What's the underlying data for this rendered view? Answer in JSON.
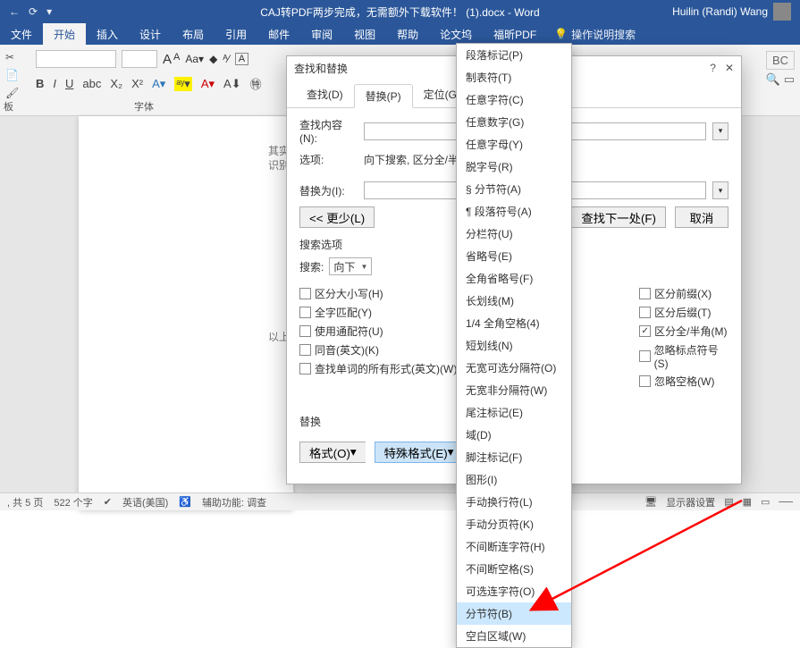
{
  "app": {
    "title": "CAJ转PDF两步完成，无需额外下载软件！ (1).docx - Word",
    "user": "Huilin (Randi) Wang"
  },
  "qat": [
    "←",
    "⟳",
    "▾"
  ],
  "ribbon_tabs": [
    {
      "label": "文件"
    },
    {
      "label": "开始",
      "active": true
    },
    {
      "label": "插入"
    },
    {
      "label": "设计"
    },
    {
      "label": "布局"
    },
    {
      "label": "引用"
    },
    {
      "label": "邮件"
    },
    {
      "label": "审阅"
    },
    {
      "label": "视图"
    },
    {
      "label": "帮助"
    },
    {
      "label": "论文坞"
    },
    {
      "label": "福昕PDF"
    }
  ],
  "ribbon": {
    "search_hint": "操作说明搜索",
    "clipboard_label": "板",
    "font_label": "字体",
    "font_size": "",
    "bold": "B",
    "italic": "I",
    "underline": "U",
    "aa_large": "A",
    "aa_small": "A"
  },
  "dialog": {
    "title": "查找和替换",
    "tabs": [
      {
        "label": "查找(D)",
        "active": false
      },
      {
        "label": "替换(P)",
        "active": true
      },
      {
        "label": "定位(G)",
        "active": false
      }
    ],
    "find_label": "查找内容(N):",
    "find_value": "",
    "options_label": "选项:",
    "options_value": "向下搜索, 区分全/半角",
    "replace_label": "替换为(I):",
    "replace_value": "",
    "less_btn": "<< 更少(L)",
    "replace_btn": "替换",
    "findnext_btn": "查找下一处(F)",
    "cancel_btn": "取消",
    "search_group": "搜索选项",
    "search_label": "搜索:",
    "search_dir": "向下",
    "checks_left": [
      {
        "label": "区分大小写(H)",
        "checked": false
      },
      {
        "label": "全字匹配(Y)",
        "checked": false
      },
      {
        "label": "使用通配符(U)",
        "checked": false
      },
      {
        "label": "同音(英文)(K)",
        "checked": false
      },
      {
        "label": "查找单词的所有形式(英文)(W)",
        "checked": false
      }
    ],
    "checks_right": [
      {
        "label": "区分前缀(X)",
        "checked": false
      },
      {
        "label": "区分后缀(T)",
        "checked": false
      },
      {
        "label": "区分全/半角(M)",
        "checked": true
      },
      {
        "label": "忽略标点符号(S)",
        "checked": false
      },
      {
        "label": "忽略空格(W)",
        "checked": false
      }
    ],
    "replace_group": "替换",
    "format_btn": "格式(O)",
    "special_btn": "特殊格式(E)"
  },
  "menu_items": [
    "段落标记(P)",
    "制表符(T)",
    "任意字符(C)",
    "任意数字(G)",
    "任意字母(Y)",
    "脱字号(R)",
    "§ 分节符(A)",
    "¶ 段落符号(A)",
    "分栏符(U)",
    "省略号(E)",
    "全角省略号(F)",
    "长划线(M)",
    "1/4 全角空格(4)",
    "短划线(N)",
    "无宽可选分隔符(O)",
    "无宽非分隔符(W)",
    "尾注标记(E)",
    "域(D)",
    "脚注标记(F)",
    "图形(I)",
    "手动换行符(L)",
    "手动分页符(K)",
    "不间断连字符(H)",
    "不间断空格(S)",
    "可选连字符(O)",
    "分节符(B)",
    "空白区域(W)"
  ],
  "menu_highlight_index": 25,
  "behind_text": {
    "t1": "其实",
    "t2": "识别",
    "t3": "以上"
  },
  "status": {
    "pages": ", 共 5 页",
    "words": "522 个字",
    "lang": "英语(美国)",
    "acc": "辅助功能: 调查",
    "display": "显示器设置"
  }
}
